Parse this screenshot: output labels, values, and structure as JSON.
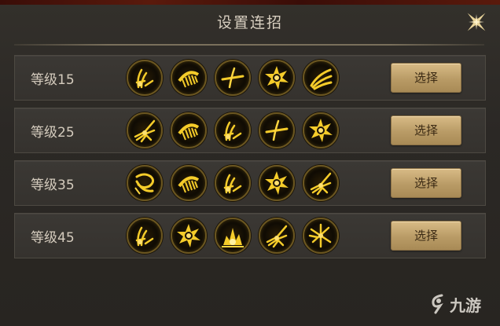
{
  "dialog": {
    "title": "设置连招",
    "close_icon": "close-star-icon"
  },
  "rows": [
    {
      "level": "等级15",
      "button": "选择",
      "skills": [
        "claw-slash-icon",
        "comb-strike-icon",
        "blade-cross-icon",
        "burst-star-icon",
        "triple-wave-icon"
      ]
    },
    {
      "level": "等级25",
      "button": "选择",
      "skills": [
        "wing-spark-icon",
        "comb-strike-icon",
        "claw-slash-icon",
        "blade-cross-icon",
        "burst-star-icon"
      ]
    },
    {
      "level": "等级35",
      "button": "选择",
      "skills": [
        "whirl-wind-icon",
        "comb-strike-icon",
        "claw-slash-icon",
        "burst-star-icon",
        "wing-spark-icon"
      ]
    },
    {
      "level": "等级45",
      "button": "选择",
      "skills": [
        "claw-slash-icon",
        "burst-star-icon",
        "explosion-icon",
        "wing-spark-icon",
        "shatter-cross-icon"
      ]
    }
  ],
  "watermark": {
    "text": "九游",
    "logo_icon": "9game-logo-icon"
  },
  "colors": {
    "accent_gold": "#f2c230",
    "button_tan": "#c9ab76",
    "text": "#d4cbbd"
  }
}
